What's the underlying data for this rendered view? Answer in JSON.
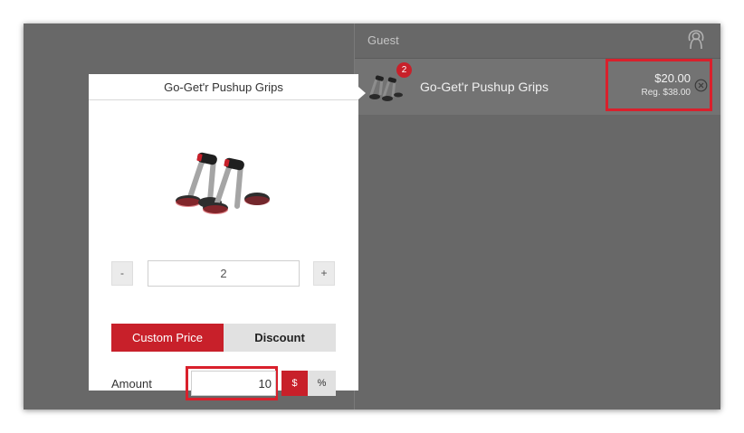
{
  "header": {
    "guest_label": "Guest"
  },
  "cart": {
    "items": [
      {
        "qty_badge": "2",
        "name": "Go-Get'r Pushup Grips",
        "price": "$20.00",
        "regular_price": "Reg. $38.00"
      }
    ]
  },
  "popup": {
    "title": "Go-Get'r Pushup Grips",
    "quantity": {
      "minus_label": "-",
      "value": "2",
      "plus_label": "+"
    },
    "tabs": [
      {
        "label": "Custom Price",
        "active": true
      },
      {
        "label": "Discount",
        "active": false
      }
    ],
    "amount": {
      "label": "Amount",
      "value": "10",
      "unit_dollar": "$",
      "unit_percent": "%",
      "selected_unit": "$"
    }
  },
  "icons": {
    "user": "user-icon",
    "remove": "remove-circle-icon",
    "product": "pushup-grips-image"
  },
  "colors": {
    "accent": "#c8202a",
    "highlight": "#d9202c",
    "background": "#686868"
  }
}
